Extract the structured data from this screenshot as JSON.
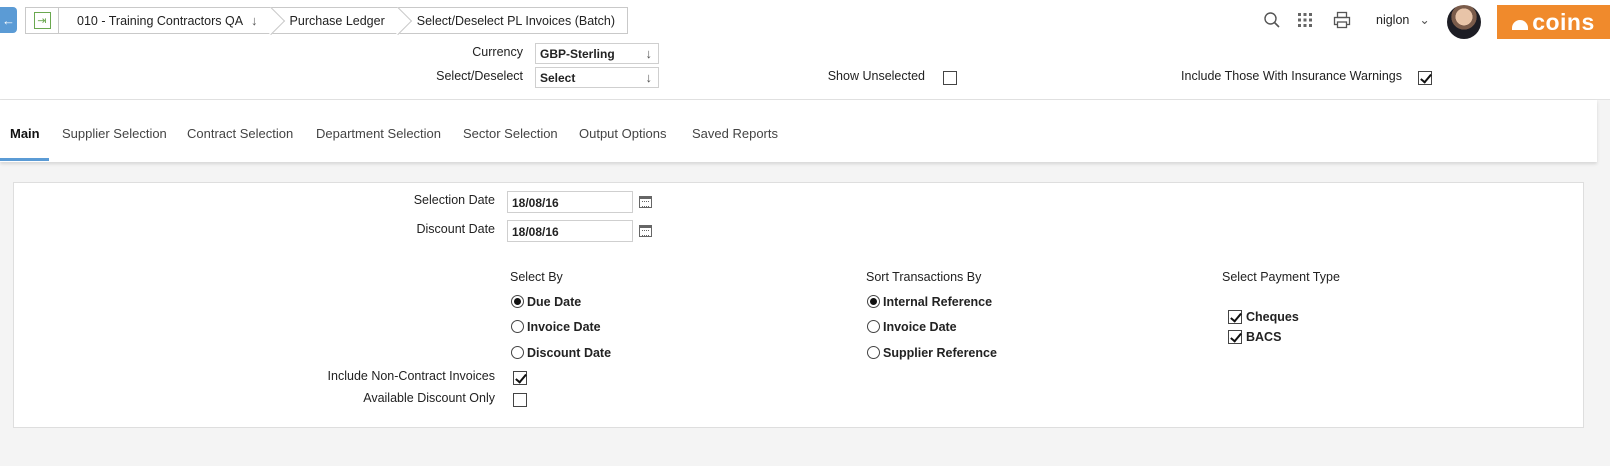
{
  "breadcrumb": {
    "company": "010 - Training Contractors QA",
    "module": "Purchase Ledger",
    "page": "Select/Deselect PL Invoices (Batch)"
  },
  "header": {
    "username": "niglon",
    "logo_text": "coins",
    "icons": [
      "search-icon",
      "apps-grid-icon",
      "print-icon"
    ]
  },
  "filters": {
    "currency_label": "Currency",
    "currency_value": "GBP-Sterling",
    "select_deselect_label": "Select/Deselect",
    "select_deselect_value": "Select",
    "show_unselected_label": "Show Unselected",
    "show_unselected_checked": false,
    "insurance_warnings_label": "Include Those With Insurance Warnings",
    "insurance_warnings_checked": true
  },
  "tabs": [
    {
      "label": "Main",
      "active": true
    },
    {
      "label": "Supplier Selection"
    },
    {
      "label": "Contract Selection"
    },
    {
      "label": "Department Selection"
    },
    {
      "label": "Sector Selection"
    },
    {
      "label": "Output Options"
    },
    {
      "label": "Saved Reports"
    }
  ],
  "main": {
    "selection_date_label": "Selection Date",
    "selection_date_value": "18/08/16",
    "discount_date_label": "Discount Date",
    "discount_date_value": "18/08/16",
    "select_by": {
      "title": "Select By",
      "options": [
        {
          "label": "Due Date",
          "selected": true
        },
        {
          "label": "Invoice Date",
          "selected": false
        },
        {
          "label": "Discount Date",
          "selected": false
        }
      ]
    },
    "sort_by": {
      "title": "Sort Transactions By",
      "options": [
        {
          "label": "Internal Reference",
          "selected": true
        },
        {
          "label": "Invoice Date",
          "selected": false
        },
        {
          "label": "Supplier Reference",
          "selected": false
        }
      ]
    },
    "payment_type": {
      "title": "Select Payment Type",
      "options": [
        {
          "label": "Cheques",
          "checked": true
        },
        {
          "label": "BACS",
          "checked": true
        }
      ]
    },
    "non_contract_label": "Include Non-Contract Invoices",
    "non_contract_checked": true,
    "available_discount_label": "Available Discount Only",
    "available_discount_checked": false
  }
}
